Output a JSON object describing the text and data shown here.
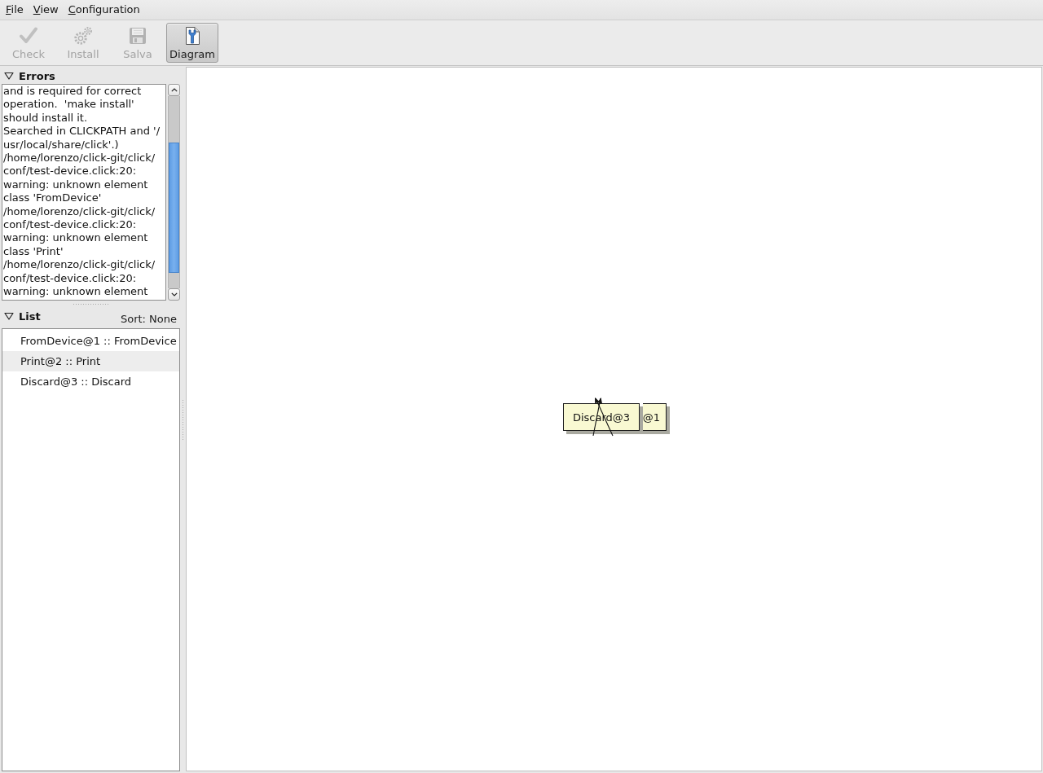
{
  "menu": [
    {
      "label": "File"
    },
    {
      "label": "View"
    },
    {
      "label": "Configuration"
    }
  ],
  "toolbar": [
    {
      "kind": "check",
      "label": "Check",
      "disabled": true,
      "selected": false
    },
    {
      "kind": "gears",
      "label": "Install",
      "disabled": true,
      "selected": false
    },
    {
      "kind": "save",
      "label": "Salva",
      "disabled": true,
      "selected": false
    },
    {
      "kind": "diagram",
      "label": "Diagram",
      "disabled": false,
      "selected": true
    }
  ],
  "errors_panel": {
    "title": "Errors",
    "expanded": true,
    "lines": [
      "and is required for correct",
      "operation.  'make install'",
      "should install it.",
      "Searched in CLICKPATH and '/",
      "usr/local/share/click'.)",
      "/home/lorenzo/click-git/click/",
      "conf/test-device.click:20:",
      "warning: unknown element",
      "class 'FromDevice'",
      "/home/lorenzo/click-git/click/",
      "conf/test-device.click:20:",
      "warning: unknown element",
      "class 'Print'",
      "/home/lorenzo/click-git/click/",
      "conf/test-device.click:20:",
      "warning: unknown element"
    ]
  },
  "list_panel": {
    "title": "List",
    "expanded": true,
    "sort": "Sort: None",
    "items": [
      {
        "label": "FromDevice@1 :: FromDevice"
      },
      {
        "label": "Print@2 :: Print"
      },
      {
        "label": "Discard@3 :: Discard"
      }
    ]
  },
  "diagram": {
    "nodes": [
      {
        "kind": "full",
        "label": "Discard@3"
      },
      {
        "kind": "partial",
        "label": "@1"
      }
    ]
  }
}
